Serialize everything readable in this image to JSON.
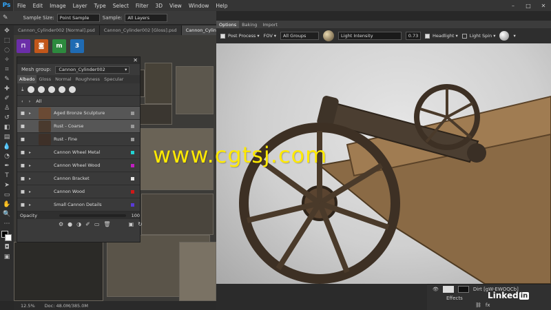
{
  "app": {
    "logo": "Ps"
  },
  "menu": [
    "File",
    "Edit",
    "Image",
    "Layer",
    "Type",
    "Select",
    "Filter",
    "3D",
    "View",
    "Window",
    "Help"
  ],
  "window_controls": [
    "–",
    "□",
    "✕"
  ],
  "options_bar": {
    "sample_size_label": "Sample Size:",
    "sample_size_value": "Point Sample",
    "sample_label": "Sample:",
    "sample_value": "All Layers"
  },
  "doc_tabs": [
    "Cannon_Cylinder002 [Normal].psd",
    "Cannon_Cylinder002 [Gloss].psd",
    "Cannon_Cylin"
  ],
  "status": {
    "zoom": "12.5%",
    "doc": "Doc: 48.0M/385.0M"
  },
  "ddo_panel": {
    "mesh_group_label": "Mesh group:",
    "mesh_group_value": "Cannon_Cylinder002",
    "channels": [
      "Albedo",
      "Gloss",
      "Normal",
      "Roughness",
      "Specular"
    ],
    "all_label": "All",
    "layers": [
      {
        "name": "Aged Bronze Sculpture",
        "thumb": "#6a4a34",
        "swatch": "#9a9a9a",
        "selected": true,
        "indent": false
      },
      {
        "name": "Rust - Coarse",
        "thumb": "#4a3a2e",
        "swatch": "#9a9a9a",
        "selected": true,
        "indent": true
      },
      {
        "name": "Rust - Fine",
        "thumb": "#3e3028",
        "swatch": "#9a9a9a",
        "selected": false,
        "indent": true
      },
      {
        "name": "Cannon Wheel Metal",
        "thumb": "",
        "swatch": "#22d3d3",
        "selected": false,
        "indent": false
      },
      {
        "name": "Cannon Wheel Wood",
        "thumb": "",
        "swatch": "#c21ec2",
        "selected": false,
        "indent": false
      },
      {
        "name": "Cannon Bracket",
        "thumb": "",
        "swatch": "#e6e6e6",
        "selected": false,
        "indent": false
      },
      {
        "name": "Cannon Wood",
        "thumb": "",
        "swatch": "#d11818",
        "selected": false,
        "indent": false
      },
      {
        "name": "Small Cannon Details",
        "thumb": "",
        "swatch": "#5a3ad6",
        "selected": false,
        "indent": false
      }
    ],
    "opacity_label": "Opacity",
    "opacity_value": "100"
  },
  "viewer": {
    "tabs": [
      "Options",
      "Baking",
      "Import"
    ],
    "post_process": "Post Process",
    "fov": "FOV",
    "groups": "All Groups",
    "light_intensity_label": "Light Intensity",
    "light_intensity_value": "0.73",
    "headlight": "Headlight",
    "light_spin": "Light Spin"
  },
  "layers_dock": {
    "item": "Dirt [gW-EWOQCb]",
    "effects": "Effects"
  },
  "watermark": "www.cgtsj.com",
  "linkedin": {
    "text": "Linked",
    "in": "in"
  }
}
